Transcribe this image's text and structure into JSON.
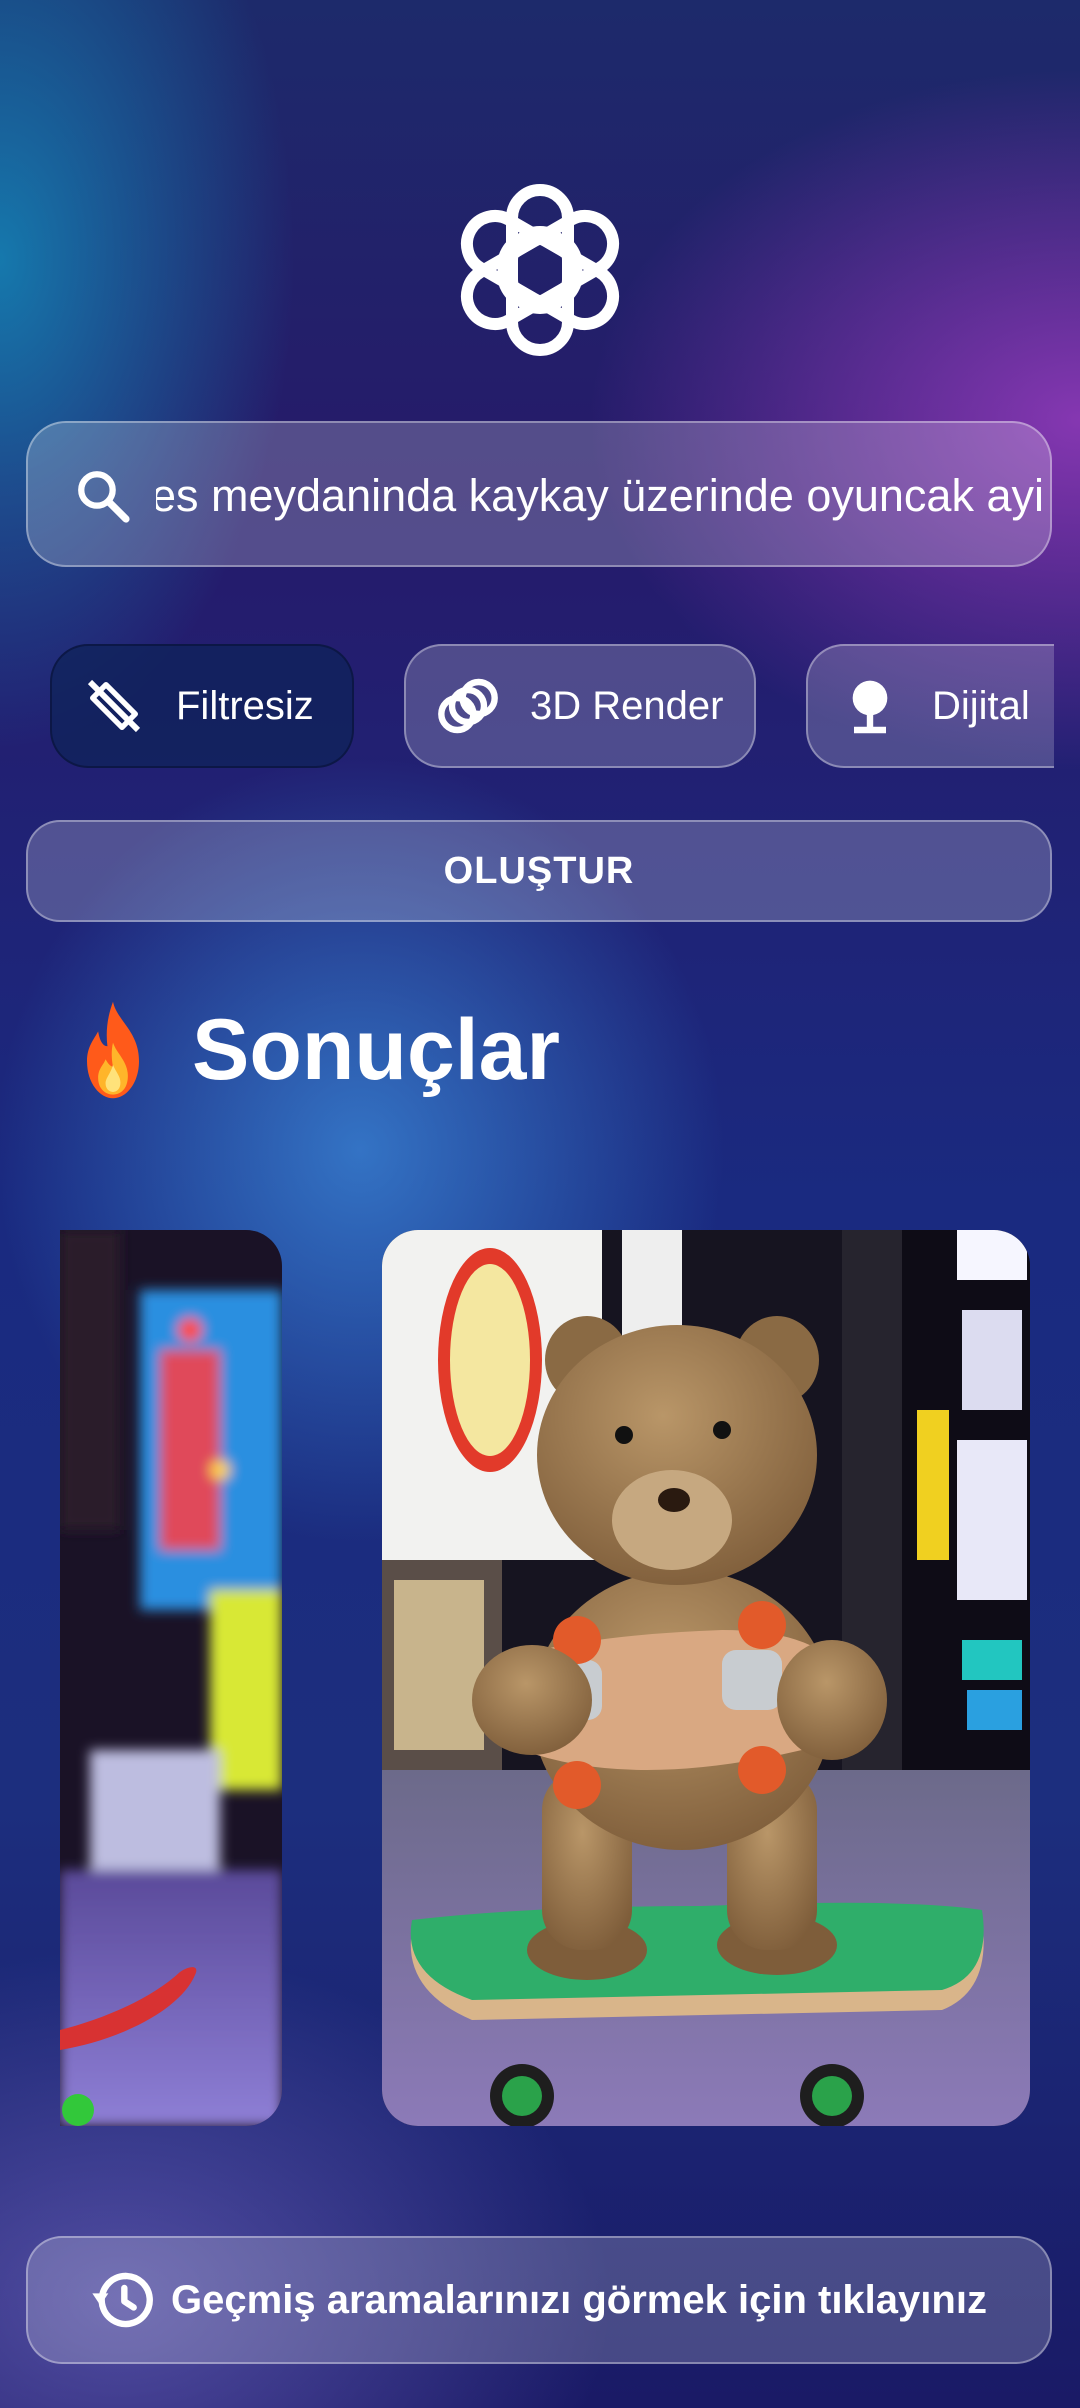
{
  "search": {
    "query": "Times meydaninda kaykay üzerinde oyuncak ayi",
    "icon": "search-icon"
  },
  "styles": [
    {
      "label": "Filtresiz",
      "icon": "no-filter-icon",
      "selected": true
    },
    {
      "label": "3D Render",
      "icon": "rings-icon",
      "selected": false
    },
    {
      "label": "Dijital",
      "icon": "pin-icon",
      "selected": false
    }
  ],
  "create_label": "OLUŞTUR",
  "results": {
    "title": "Sonuçlar",
    "icon": "fire-icon",
    "images": [
      {
        "description_icon": "skateboard-city-image"
      },
      {
        "description_icon": "teddy-bear-skateboard-image"
      }
    ]
  },
  "history_label": "Geçmiş aramalarınızı görmek için tıklayınız",
  "colors": {
    "chip_active": "#13285a",
    "accent_fire": "#ff7a1a"
  }
}
